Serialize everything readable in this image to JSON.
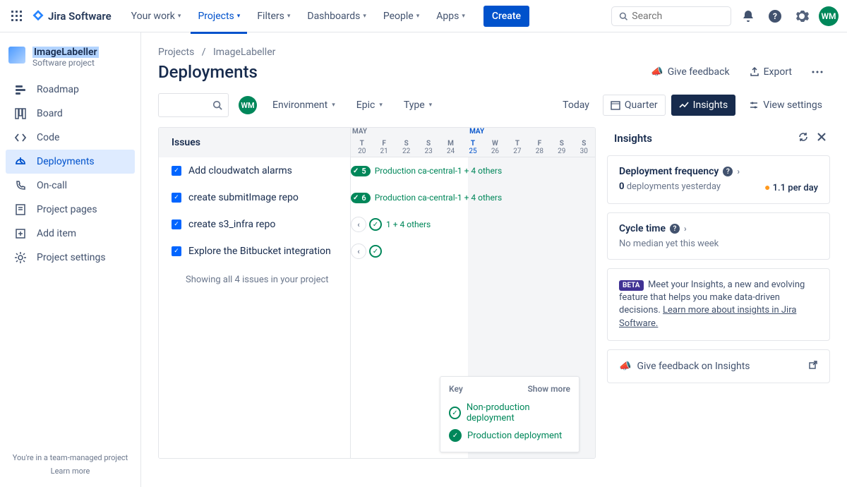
{
  "brand": "Jira Software",
  "nav": {
    "items": [
      "Your work",
      "Projects",
      "Filters",
      "Dashboards",
      "People",
      "Apps"
    ],
    "create": "Create",
    "search_placeholder": "Search"
  },
  "avatar_initials": "WM",
  "sidebar": {
    "project_name": "ImageLabeller",
    "project_sub": "Software project",
    "items": [
      {
        "label": "Roadmap"
      },
      {
        "label": "Board"
      },
      {
        "label": "Code"
      },
      {
        "label": "Deployments"
      },
      {
        "label": "On-call"
      },
      {
        "label": "Project pages"
      },
      {
        "label": "Add item"
      },
      {
        "label": "Project settings"
      }
    ],
    "footer_top": "You're in a team-managed project",
    "footer_link": "Learn more"
  },
  "crumbs": {
    "root": "Projects",
    "sep": "/",
    "current": "ImageLabeller"
  },
  "page": {
    "title": "Deployments",
    "feedback": "Give feedback",
    "export": "Export"
  },
  "filters": {
    "environment": "Environment",
    "epic": "Epic",
    "type": "Type"
  },
  "view": {
    "today": "Today",
    "quarter": "Quarter",
    "insights": "Insights",
    "settings": "View settings"
  },
  "timeline": {
    "issues_header": "Issues",
    "month": "MAY",
    "days": [
      {
        "d": "T",
        "n": "20"
      },
      {
        "d": "F",
        "n": "21"
      },
      {
        "d": "S",
        "n": "22"
      },
      {
        "d": "S",
        "n": "23"
      },
      {
        "d": "M",
        "n": "24"
      },
      {
        "d": "T",
        "n": "25"
      },
      {
        "d": "W",
        "n": "26"
      },
      {
        "d": "T",
        "n": "27"
      },
      {
        "d": "F",
        "n": "28"
      },
      {
        "d": "S",
        "n": "29"
      },
      {
        "d": "S",
        "n": "30"
      }
    ],
    "issues": [
      {
        "title": "Add cloudwatch alarms",
        "badge": "5",
        "label": "Production ca-central-1 + 4 others"
      },
      {
        "title": "create submitImage repo",
        "badge": "6",
        "label": "Production ca-central-1 + 4 others"
      },
      {
        "title": "create s3_infra repo",
        "label": "1 + 4 others"
      },
      {
        "title": "Explore the Bitbucket integration"
      }
    ],
    "showing": "Showing all 4 issues in your project"
  },
  "key": {
    "title": "Key",
    "more": "Show more",
    "nonprod": "Non-production deployment",
    "prod": "Production deployment"
  },
  "insights": {
    "title": "Insights",
    "freq_title": "Deployment frequency",
    "freq_sub": "0 deployments yesterday",
    "freq_rate": "1.1 per day",
    "cycle_title": "Cycle time",
    "cycle_sub": "No median yet this week",
    "beta_tag": "BETA",
    "beta_text": "Meet your Insights, a new and evolving feature that helps you make data-driven decisions.",
    "beta_link": "Learn more about insights in Jira Software.",
    "feedback": "Give feedback on Insights"
  }
}
